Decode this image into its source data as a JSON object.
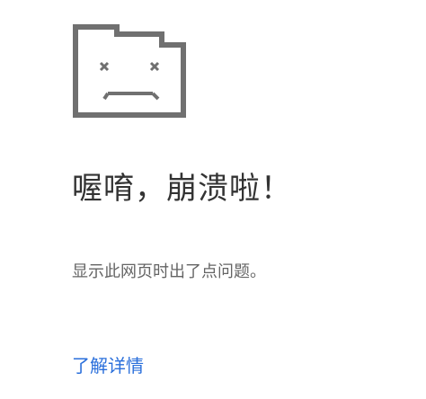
{
  "error_page": {
    "icon": "sad-tab-icon",
    "heading": "喔唷，崩溃啦！",
    "message": "显示此网页时出了点问题。",
    "learn_more_label": "了解详情"
  },
  "colors": {
    "heading": "#333333",
    "message": "#646464",
    "link": "#2a6fdb",
    "icon": "#707070"
  }
}
